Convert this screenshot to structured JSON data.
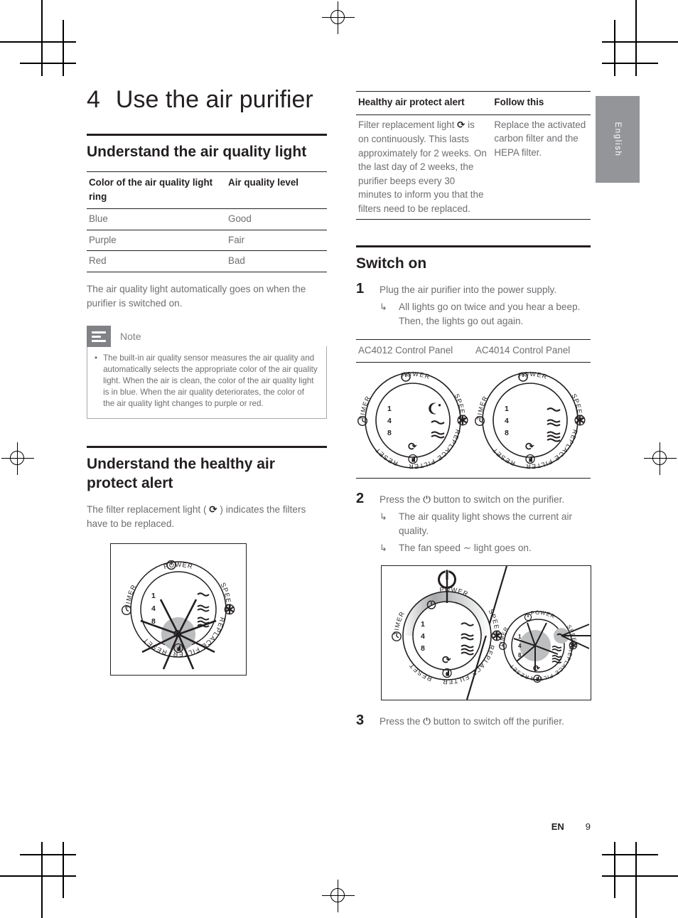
{
  "page": {
    "language_tab": "English",
    "footer_locale": "EN",
    "footer_page": "9"
  },
  "chapter": {
    "number": "4",
    "title": "Use the air purifier"
  },
  "sections": {
    "air_quality_light": {
      "heading": "Understand the air quality light",
      "table": {
        "headers": [
          "Color of the air quality light ring",
          "Air quality level"
        ],
        "rows": [
          [
            "Blue",
            "Good"
          ],
          [
            "Purple",
            "Fair"
          ],
          [
            "Red",
            "Bad"
          ]
        ]
      },
      "paragraph": "The air quality light automatically goes on when the purifier is switched on.",
      "note": {
        "label": "Note",
        "icon": "note-lines-icon",
        "bullet": "•",
        "items": [
          "The built-in air quality sensor measures the air quality and automatically selects the appropriate color of the air quality light. When the air is clean, the color of the air quality light is in blue. When the air quality deteriorates, the color of the air quality light changes to purple or red."
        ]
      }
    },
    "healthy_air_protect_alert": {
      "heading": "Understand the healthy air protect alert",
      "paragraph_before_icon": "The filter replacement light ( ",
      "paragraph_icon": "filter-replacement-icon",
      "paragraph_after_icon": " ) indicates the filters have to be replaced.",
      "figure_caption": "control-panel-filter-light-flashing"
    },
    "alert_table": {
      "headers": [
        "Healthy air protect alert",
        "Follow this"
      ],
      "rows": [
        {
          "alert_before_icon": "Filter replacement light ",
          "alert_icon": "filter-replacement-icon",
          "alert_after_icon": " is on continuously. This lasts approximately for 2 weeks. On the last day of 2 weeks, the purifier beeps every 30 minutes to inform you that the filters need to be replaced.",
          "follow": "Replace the activated carbon filter and the HEPA filter."
        }
      ]
    },
    "switch_on": {
      "heading": "Switch on",
      "steps": [
        {
          "number": "1",
          "text": "Plug the air purifier into the power supply.",
          "subs": [
            "All lights go on twice and you hear a beep. Then, the lights go out again."
          ]
        },
        {
          "number": "2",
          "text_before_icon": "Press the ",
          "text_icon": "power-icon",
          "text_after_icon": " button to switch on the purifier.",
          "subs": [
            "The air quality light shows the current air quality.",
            "The fan speed ∼ light goes on."
          ]
        },
        {
          "number": "3",
          "text_before_icon": "Press the ",
          "text_icon": "power-icon",
          "text_after_icon": " button to switch off the purifier."
        }
      ],
      "panel_table": {
        "headers": [
          "AC4012 Control Panel",
          "AC4014 Control Panel"
        ]
      }
    }
  },
  "control_panel": {
    "labels": {
      "power": "POWER",
      "timer": "TIMER",
      "speed": "SPEED",
      "replace_filter": "REPLACE FILTER",
      "reset": "RESET"
    },
    "timer_values": [
      "1",
      "4",
      "8"
    ],
    "icons": {
      "power": "power-icon",
      "clock": "clock-icon",
      "fan": "fan-icon",
      "filter_replace": "filter-replacement-icon",
      "reset_hand": "hand-press-icon",
      "night_mode": "moon-icon",
      "speed_low": "wave-1-icon",
      "speed_medium": "wave-2-icon",
      "speed_high": "wave-3-icon"
    },
    "ac4012_speed_icons": [
      "moon-icon",
      "wave-1-icon",
      "wave-2-icon"
    ],
    "ac4014_speed_icons": [
      "wave-1-icon",
      "wave-2-icon",
      "wave-3-icon"
    ]
  },
  "colors": {
    "text_dark": "#231f20",
    "text_body": "#6d6e71",
    "tab_gray": "#939598",
    "note_icon_gray": "#808285",
    "highlight_gray": "#bcbec0"
  }
}
